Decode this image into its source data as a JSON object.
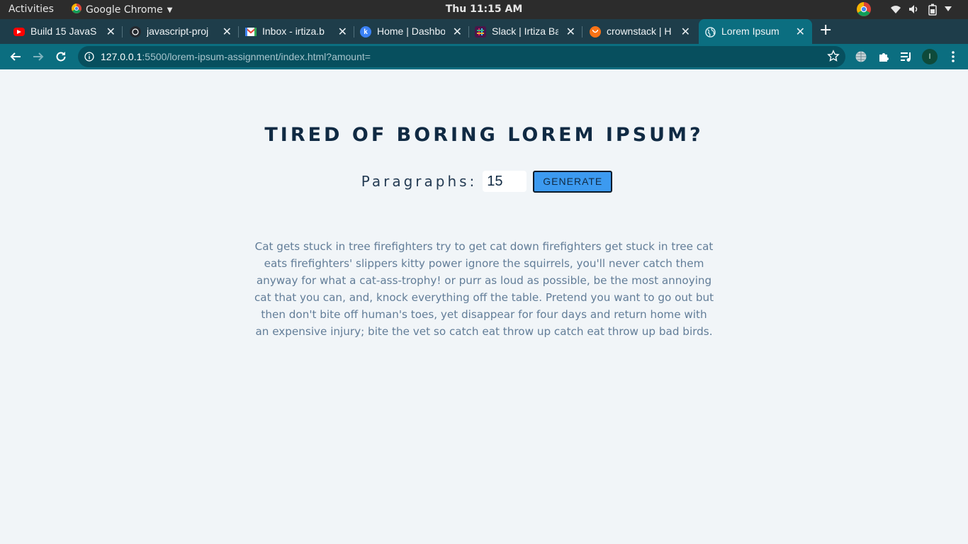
{
  "system_bar": {
    "activities": "Activities",
    "app_name": "Google Chrome",
    "clock": "Thu 11:15 AM",
    "tray_icons": [
      "chrome-icon",
      "wifi-icon",
      "volume-icon",
      "battery-icon",
      "power-menu-icon"
    ]
  },
  "tabs": [
    {
      "title": "Build 15 JavaS",
      "favicon": "youtube-icon",
      "color": "#ff0000",
      "active": false
    },
    {
      "title": "javascript-proj",
      "favicon": "github-icon",
      "color": "#24292e",
      "active": false
    },
    {
      "title": "Inbox - irtiza.b",
      "favicon": "gmail-icon",
      "color": "#ea4335",
      "active": false
    },
    {
      "title": "Home | Dashbo",
      "favicon": "k-icon",
      "color": "#3b82f6",
      "active": false
    },
    {
      "title": "Slack | Irtiza Ba",
      "favicon": "slack-icon",
      "color": "#4a154b",
      "active": false
    },
    {
      "title": "crownstack | H",
      "favicon": "crownstack-icon",
      "color": "#f97316",
      "active": false
    },
    {
      "title": "Lorem Ipsum",
      "favicon": "globe-icon",
      "color": "#0b6e80",
      "active": true
    }
  ],
  "toolbar": {
    "url_host": "127.0.0.1",
    "url_rest": ":5500/lorem-ipsum-assignment/index.html?amount=",
    "profile_initial": "I"
  },
  "page": {
    "heading": "tired of boring lorem ipsum?",
    "form": {
      "label": "Paragraphs:",
      "amount_value": "15",
      "button_label": "generate"
    },
    "paragraphs": [
      "Cat gets stuck in tree firefighters try to get cat down firefighters get stuck in tree cat eats firefighters' slippers kitty power ignore the squirrels, you'll never catch them anyway for what a cat-ass-trophy! or purr as loud as possible, be the most annoying cat that you can, and, knock everything off the table. Pretend you want to go out but then don't bite off human's toes, yet disappear for four days and return home with an expensive injury; bite the vet so catch eat throw up catch eat throw up bad birds."
    ]
  },
  "colors": {
    "tab_strip": "#1e3d4a",
    "toolbar": "#0b6e80",
    "page_background": "#f1f5f8",
    "heading": "#102a43",
    "button": "#3c9af0",
    "paragraph_text": "#627d98"
  }
}
